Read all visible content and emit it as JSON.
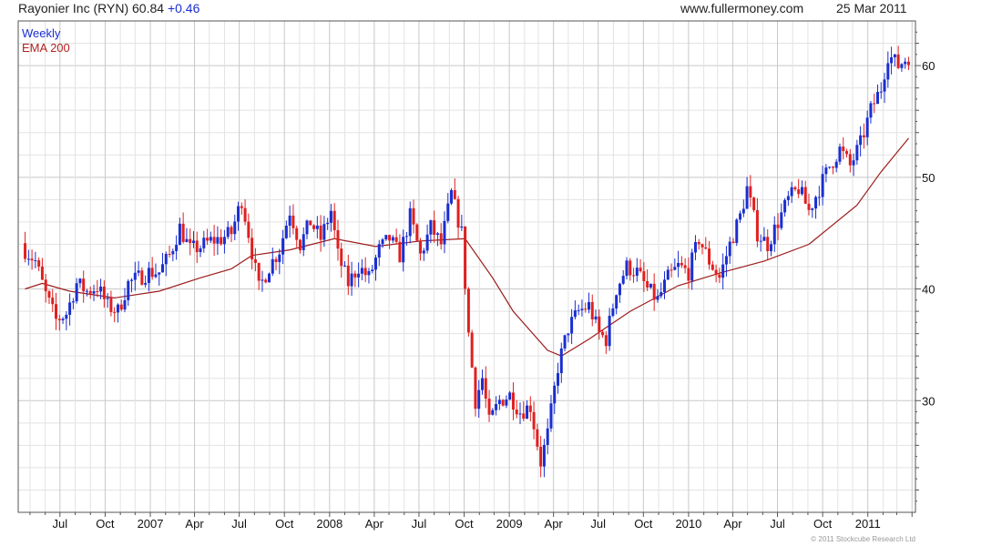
{
  "header": {
    "title": "Rayonier Inc (RYN) 60.84",
    "change": "+0.46",
    "site": "www.fullermoney.com",
    "date": "25 Mar 2011"
  },
  "legend": {
    "weekly": "Weekly",
    "ema": "EMA 200"
  },
  "copyright": "© 2011 Stockcube Research Ltd",
  "colors": {
    "up_candle": "#1a2fd0",
    "down_candle": "#e02020",
    "ema_line": "#9b1c1c",
    "grid": "#e3e3e3",
    "major_grid": "#c8c8c8"
  },
  "chart_data": {
    "type": "candlestick",
    "title": "Rayonier Inc (RYN) 60.84 +0.46",
    "x_tick_labels": [
      "Jul",
      "Oct",
      "2007",
      "Apr",
      "Jul",
      "Oct",
      "2008",
      "Apr",
      "Jul",
      "Oct",
      "2009",
      "Apr",
      "Jul",
      "Oct",
      "2010",
      "Apr",
      "Jul",
      "Oct",
      "2011"
    ],
    "y_tick_labels": [
      "30",
      "40",
      "50",
      "60"
    ],
    "ylim": [
      20,
      64
    ],
    "grid": true,
    "legend_position": "top-left",
    "series": [
      {
        "name": "Weekly",
        "type": "candlestick",
        "close_anchors": [
          [
            "2006-04-21",
            43.5
          ],
          [
            "2006-05-12",
            42.5
          ],
          [
            "2006-06-02",
            39.5
          ],
          [
            "2006-06-23",
            37.2
          ],
          [
            "2006-07-14",
            37.8
          ],
          [
            "2006-08-04",
            40.5
          ],
          [
            "2006-08-25",
            39.8
          ],
          [
            "2006-09-15",
            40.2
          ],
          [
            "2006-10-06",
            38.5
          ],
          [
            "2006-10-27",
            38.0
          ],
          [
            "2006-11-17",
            40.5
          ],
          [
            "2006-12-08",
            41.0
          ],
          [
            "2006-12-29",
            41.5
          ],
          [
            "2007-01-19",
            41.5
          ],
          [
            "2007-02-09",
            43.0
          ],
          [
            "2007-03-02",
            45.5
          ],
          [
            "2007-03-23",
            43.5
          ],
          [
            "2007-04-13",
            43.8
          ],
          [
            "2007-05-04",
            44.3
          ],
          [
            "2007-05-25",
            44.5
          ],
          [
            "2007-06-15",
            45.0
          ],
          [
            "2007-07-06",
            48.0
          ],
          [
            "2007-07-20",
            45.0
          ],
          [
            "2007-08-10",
            40.0
          ],
          [
            "2007-08-31",
            42.0
          ],
          [
            "2007-09-21",
            43.5
          ],
          [
            "2007-10-12",
            47.0
          ],
          [
            "2007-11-02",
            44.0
          ],
          [
            "2007-11-23",
            46.0
          ],
          [
            "2007-12-14",
            44.5
          ],
          [
            "2008-01-04",
            47.0
          ],
          [
            "2008-01-18",
            43.0
          ],
          [
            "2008-02-08",
            40.5
          ],
          [
            "2008-02-29",
            42.0
          ],
          [
            "2008-03-21",
            41.0
          ],
          [
            "2008-04-11",
            43.5
          ],
          [
            "2008-05-02",
            44.5
          ],
          [
            "2008-05-23",
            43.0
          ],
          [
            "2008-06-13",
            46.5
          ],
          [
            "2008-07-04",
            43.0
          ],
          [
            "2008-07-25",
            45.5
          ],
          [
            "2008-08-15",
            44.0
          ],
          [
            "2008-09-05",
            48.5
          ],
          [
            "2008-09-26",
            45.0
          ],
          [
            "2008-10-10",
            36.0
          ],
          [
            "2008-10-24",
            30.0
          ],
          [
            "2008-11-07",
            32.0
          ],
          [
            "2008-11-21",
            28.0
          ],
          [
            "2008-12-12",
            30.0
          ],
          [
            "2009-01-02",
            30.5
          ],
          [
            "2009-01-23",
            29.0
          ],
          [
            "2009-02-13",
            29.5
          ],
          [
            "2009-03-06",
            24.5
          ],
          [
            "2009-03-20",
            27.0
          ],
          [
            "2009-04-10",
            33.0
          ],
          [
            "2009-05-01",
            36.5
          ],
          [
            "2009-05-22",
            38.0
          ],
          [
            "2009-06-12",
            38.5
          ],
          [
            "2009-07-03",
            36.0
          ],
          [
            "2009-07-17",
            35.5
          ],
          [
            "2009-08-07",
            40.0
          ],
          [
            "2009-08-28",
            42.0
          ],
          [
            "2009-09-18",
            41.5
          ],
          [
            "2009-10-09",
            40.0
          ],
          [
            "2009-10-30",
            39.0
          ],
          [
            "2009-11-20",
            41.0
          ],
          [
            "2009-12-11",
            42.0
          ],
          [
            "2010-01-01",
            41.5
          ],
          [
            "2010-01-22",
            44.5
          ],
          [
            "2010-02-12",
            42.5
          ],
          [
            "2010-03-05",
            41.0
          ],
          [
            "2010-03-26",
            44.0
          ],
          [
            "2010-04-16",
            46.5
          ],
          [
            "2010-04-30",
            49.0
          ],
          [
            "2010-05-21",
            45.0
          ],
          [
            "2010-06-11",
            44.0
          ],
          [
            "2010-07-02",
            46.0
          ],
          [
            "2010-07-23",
            48.0
          ],
          [
            "2010-08-13",
            49.0
          ],
          [
            "2010-09-03",
            47.0
          ],
          [
            "2010-09-24",
            49.0
          ],
          [
            "2010-10-15",
            51.0
          ],
          [
            "2010-11-05",
            52.5
          ],
          [
            "2010-11-26",
            51.0
          ],
          [
            "2010-12-17",
            53.0
          ],
          [
            "2011-01-07",
            56.0
          ],
          [
            "2011-01-28",
            58.0
          ],
          [
            "2011-02-11",
            61.0
          ],
          [
            "2011-03-04",
            60.0
          ],
          [
            "2011-03-25",
            60.84
          ]
        ]
      },
      {
        "name": "EMA 200",
        "type": "line",
        "points": [
          [
            "2006-04-21",
            40.0
          ],
          [
            "2006-05-26",
            40.5
          ],
          [
            "2006-07-21",
            39.8
          ],
          [
            "2006-10-20",
            39.2
          ],
          [
            "2007-01-19",
            39.8
          ],
          [
            "2007-04-13",
            41.0
          ],
          [
            "2007-06-15",
            41.8
          ],
          [
            "2007-07-27",
            43.0
          ],
          [
            "2007-10-12",
            43.5
          ],
          [
            "2008-01-11",
            44.5
          ],
          [
            "2008-04-04",
            43.8
          ],
          [
            "2008-07-04",
            44.3
          ],
          [
            "2008-10-03",
            44.5
          ],
          [
            "2008-11-28",
            41.0
          ],
          [
            "2009-01-09",
            38.0
          ],
          [
            "2009-03-20",
            34.5
          ],
          [
            "2009-04-17",
            34.0
          ],
          [
            "2009-06-12",
            35.5
          ],
          [
            "2009-09-04",
            38.0
          ],
          [
            "2009-12-11",
            40.3
          ],
          [
            "2010-03-12",
            41.5
          ],
          [
            "2010-06-04",
            42.5
          ],
          [
            "2010-09-03",
            44.0
          ],
          [
            "2010-12-10",
            47.5
          ],
          [
            "2011-01-28",
            50.5
          ],
          [
            "2011-03-25",
            53.5
          ]
        ]
      }
    ]
  }
}
